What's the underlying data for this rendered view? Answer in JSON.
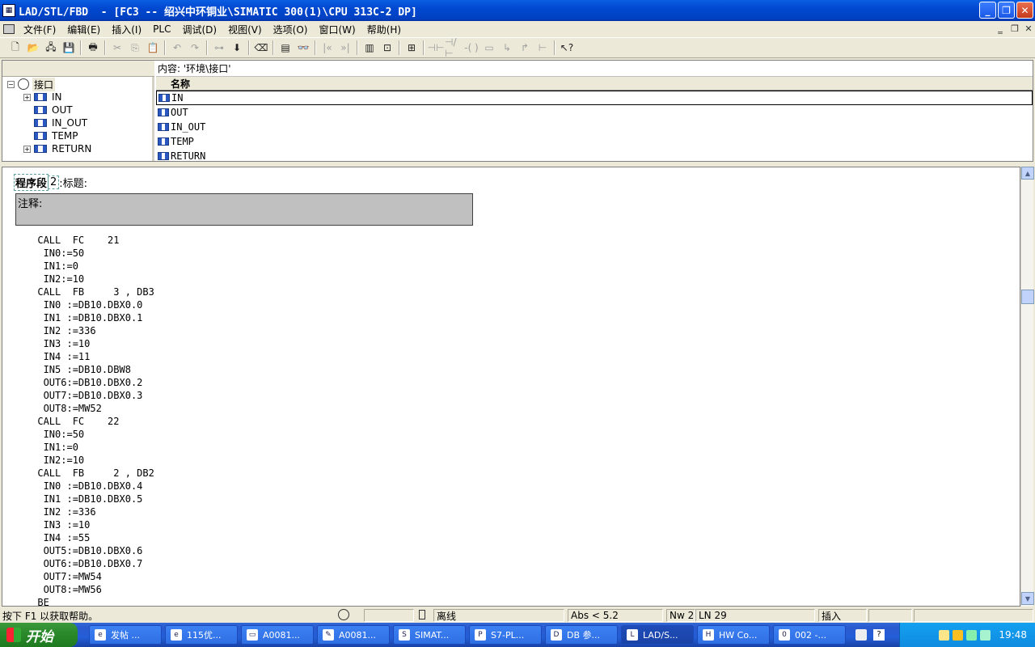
{
  "window": {
    "title": "LAD/STL/FBD  - [FC3 -- 绍兴中环铜业\\SIMATIC 300(1)\\CPU 313C-2 DP]"
  },
  "menu": {
    "items": [
      "文件(F)",
      "编辑(E)",
      "插入(I)",
      "PLC",
      "调试(D)",
      "视图(V)",
      "选项(O)",
      "窗口(W)",
      "帮助(H)"
    ]
  },
  "interface": {
    "content_label": "内容:  '环境\\接口'",
    "column_name": "名称",
    "tree": {
      "root": "接口",
      "children": [
        "IN",
        "OUT",
        "IN_OUT",
        "TEMP",
        "RETURN"
      ]
    },
    "rows": [
      "IN",
      "OUT",
      "IN_OUT",
      "TEMP",
      "RETURN"
    ]
  },
  "editor": {
    "segment_label": "程序段",
    "segment_number": "2",
    "segment_title_label": ":标题:",
    "comment_label": "注释:",
    "code": [
      "      CALL  FC    21",
      "       IN0:=50",
      "       IN1:=0",
      "       IN2:=10",
      "      CALL  FB     3 , DB3",
      "       IN0 :=DB10.DBX0.0",
      "       IN1 :=DB10.DBX0.1",
      "       IN2 :=336",
      "       IN3 :=10",
      "       IN4 :=11",
      "       IN5 :=DB10.DBW8",
      "       OUT6:=DB10.DBX0.2",
      "       OUT7:=DB10.DBX0.3",
      "       OUT8:=MW52",
      "      CALL  FC    22",
      "       IN0:=50",
      "       IN1:=0",
      "       IN2:=10",
      "      CALL  FB     2 , DB2",
      "       IN0 :=DB10.DBX0.4",
      "       IN1 :=DB10.DBX0.5",
      "       IN2 :=336",
      "       IN3 :=10",
      "       IN4 :=55",
      "       OUT5:=DB10.DBX0.6",
      "       OUT6:=DB10.DBX0.7",
      "       OUT7:=MW54",
      "       OUT8:=MW56",
      "      BE"
    ]
  },
  "status": {
    "help": "按下 F1 以获取帮助。",
    "mode": "离线",
    "abs": "Abs < 5.2",
    "nw": "Nw 2",
    "ln": "LN 29",
    "insert": "插入"
  },
  "taskbar": {
    "start": "开始",
    "tasks": [
      "发帖 ...",
      "115优...",
      "A0081...",
      "A0081...",
      "SIMAT...",
      "S7-PL...",
      "DB 参...",
      "LAD/S...",
      "HW Co...",
      "002 -..."
    ],
    "clock": "19:48"
  }
}
